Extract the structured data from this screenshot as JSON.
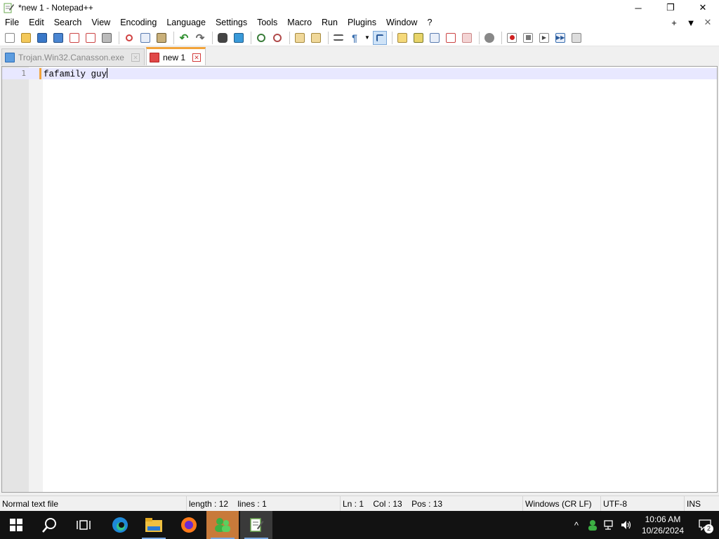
{
  "window": {
    "title": "*new 1 - Notepad++",
    "controls": {
      "minimize": "─",
      "maximize": "❐",
      "close": "✕"
    }
  },
  "menu": {
    "items": [
      "File",
      "Edit",
      "Search",
      "View",
      "Encoding",
      "Language",
      "Settings",
      "Tools",
      "Macro",
      "Run",
      "Plugins",
      "Window",
      "?"
    ],
    "right": {
      "add": "+",
      "list": "▼",
      "close": "✕"
    }
  },
  "toolbar": {
    "icons": [
      "new-file-icon",
      "open-file-icon",
      "save-icon",
      "save-all-icon",
      "close-icon",
      "close-all-icon",
      "print-icon",
      "cut-icon",
      "copy-icon",
      "paste-icon",
      "undo-icon",
      "redo-icon",
      "find-icon",
      "replace-icon",
      "zoom-in-icon",
      "zoom-out-icon",
      "sync-vertical-icon",
      "sync-horizontal-icon",
      "word-wrap-icon",
      "show-all-chars-icon",
      "indent-guide-icon",
      "user-language-icon",
      "doc-map-icon",
      "function-list-icon",
      "folder-workspace-icon",
      "monitoring-icon",
      "record-macro-icon",
      "stop-record-icon",
      "play-macro-icon",
      "run-macro-multiple-icon",
      "save-macro-icon"
    ]
  },
  "tabs": [
    {
      "label": "Trojan.Win32.Canasson.exe",
      "active": false
    },
    {
      "label": "new 1",
      "active": true
    }
  ],
  "editor": {
    "line_number": "1",
    "text": "fafamily guy"
  },
  "status": {
    "filetype": "Normal text file",
    "length": "length : 12",
    "lines": "lines : 1",
    "ln": "Ln : 1",
    "col": "Col : 13",
    "pos": "Pos : 13",
    "eol": "Windows (CR LF)",
    "encoding": "UTF-8",
    "mode": "INS"
  },
  "taskbar": {
    "time": "10:06 AM",
    "date": "10/26/2024",
    "notification_count": "2"
  },
  "colors": {
    "tab_accent": "#f2a33a",
    "current_line": "#e8e8ff",
    "taskbar": "#121212"
  }
}
